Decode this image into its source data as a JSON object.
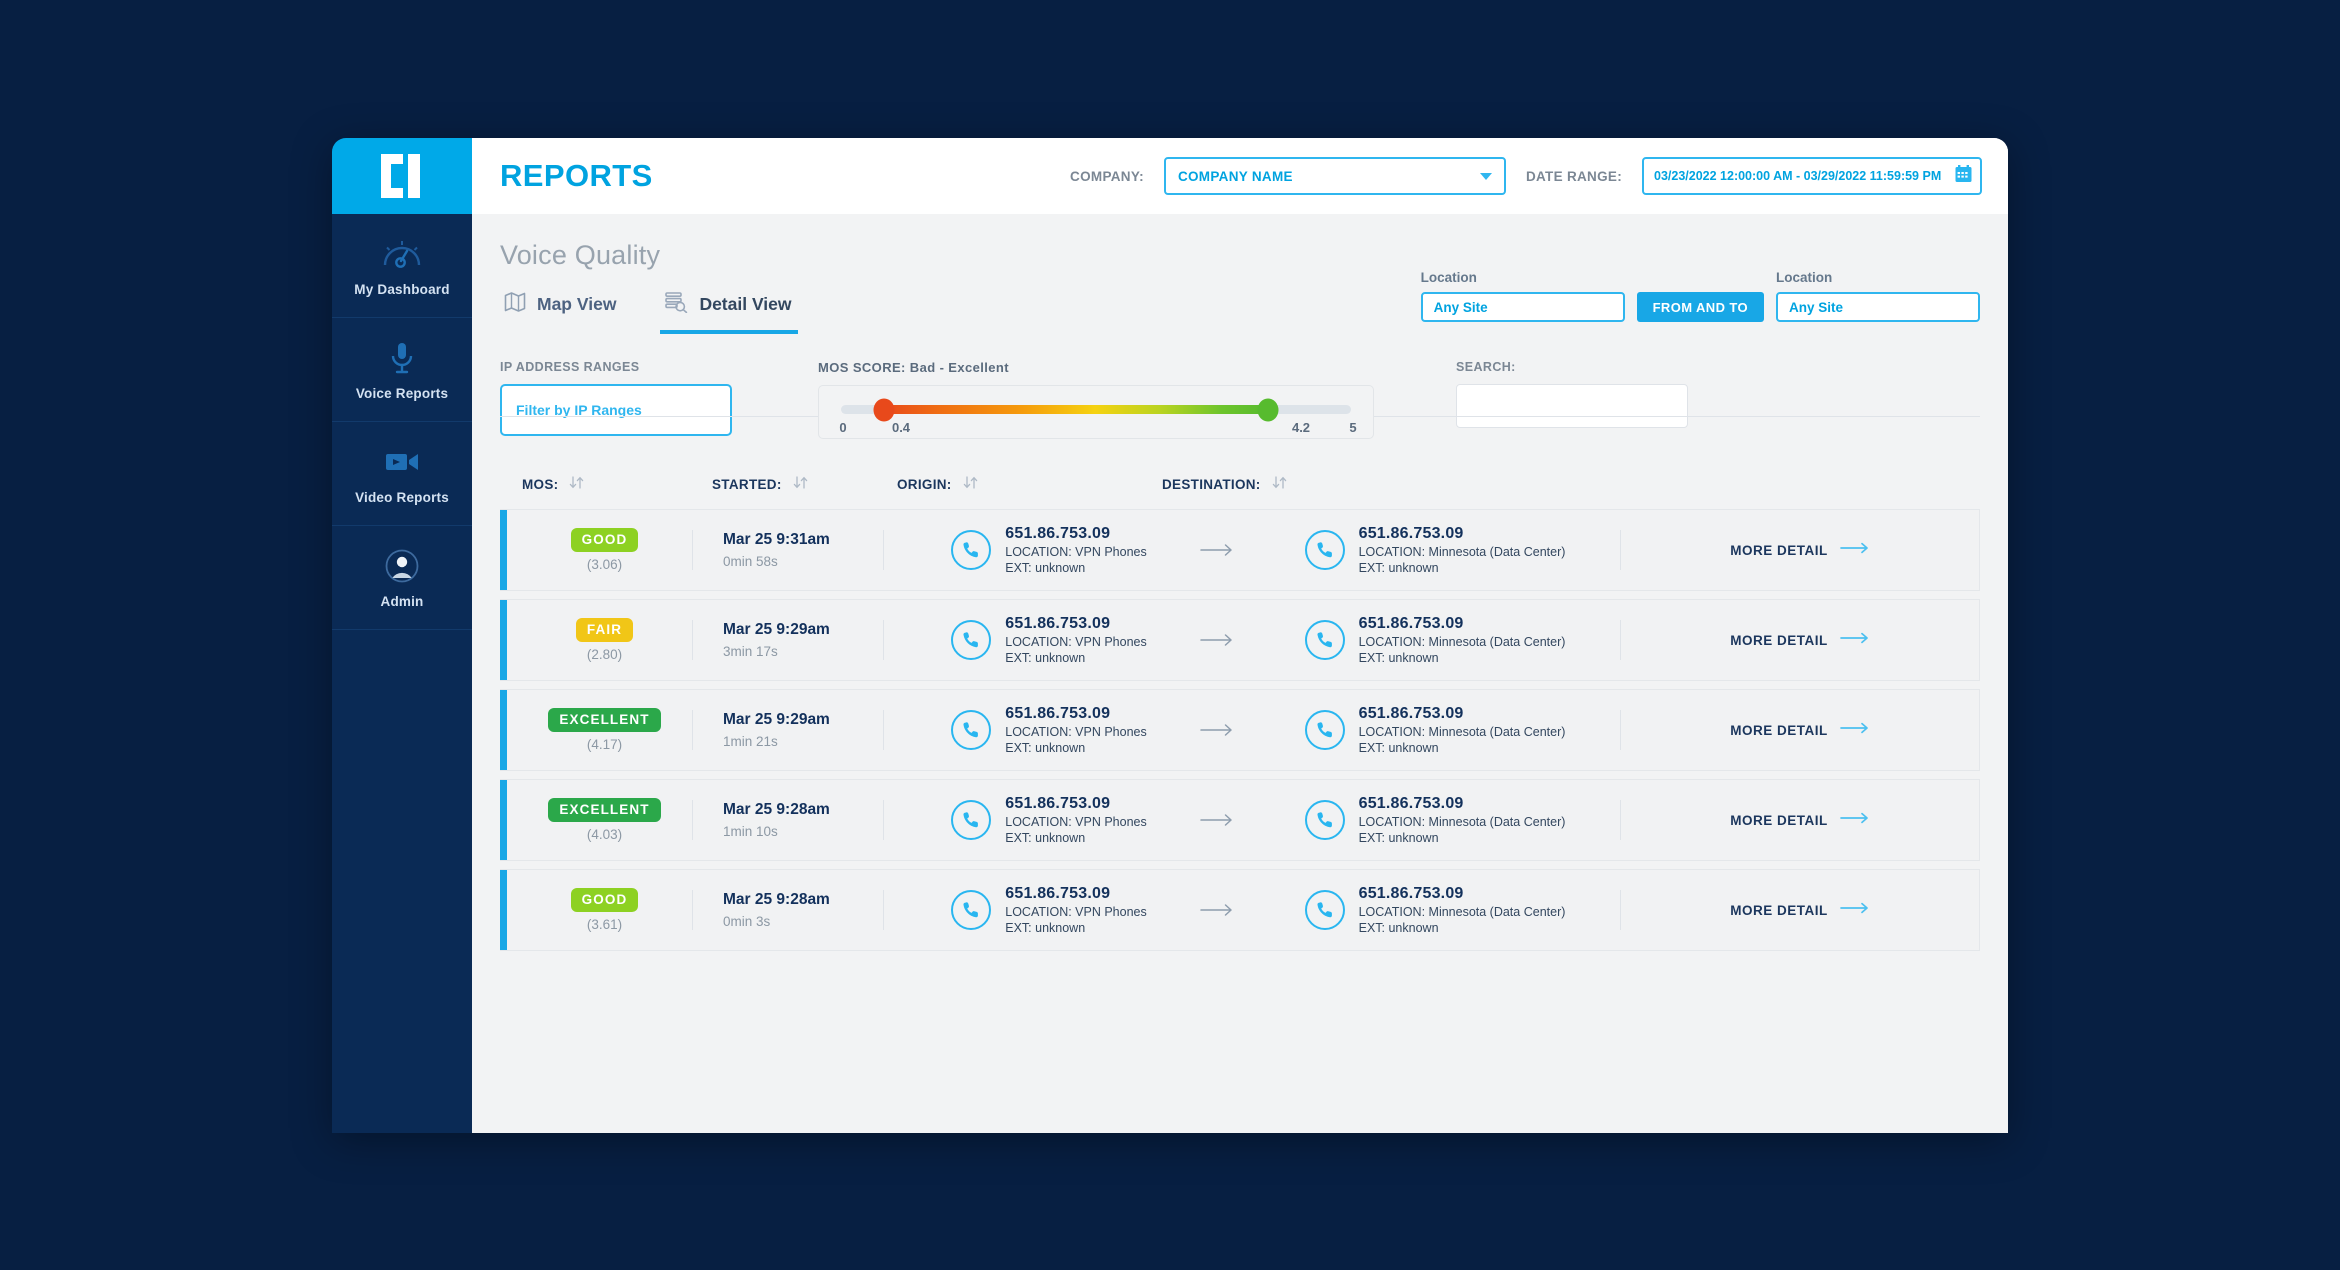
{
  "sidebar": {
    "logo_name": "c1-logo",
    "items": [
      {
        "label": "My Dashboard",
        "icon": "gauge-icon"
      },
      {
        "label": "Voice Reports",
        "icon": "microphone-icon"
      },
      {
        "label": "Video Reports",
        "icon": "video-camera-icon"
      },
      {
        "label": "Admin",
        "icon": "user-avatar-icon"
      }
    ]
  },
  "topbar": {
    "title": "REPORTS",
    "company_label": "COMPANY:",
    "company_value": "COMPANY NAME",
    "date_range_label": "DATE RANGE:",
    "date_range_value": "03/23/2022 12:00:00 AM - 03/29/2022 11:59:59 PM"
  },
  "section": {
    "title": "Voice Quality",
    "tabs": [
      {
        "label": "Map View",
        "icon": "map-icon",
        "active": false
      },
      {
        "label": "Detail View",
        "icon": "detail-list-search-icon",
        "active": true
      }
    ]
  },
  "location": {
    "from_caption": "Location",
    "from_value": "Any Site",
    "button_label": "FROM AND TO",
    "to_caption": "Location",
    "to_value": "Any Site"
  },
  "filters": {
    "ip_caption": "IP ADDRESS RANGES",
    "ip_placeholder": "Filter by IP Ranges",
    "mos_caption": "MOS SCORE: Bad - Excellent",
    "mos_ticks": {
      "min": "0",
      "low": "0.4",
      "high": "4.2",
      "max": "5"
    },
    "search_caption": "SEARCH:",
    "search_value": ""
  },
  "table": {
    "headers": {
      "mos": "MOS:",
      "started": "STARTED:",
      "origin": "ORIGIN:",
      "destination": "DESTINATION:"
    },
    "sort_icon": "sort-updown-icon",
    "more_detail_label": "MORE DETAIL",
    "rows": [
      {
        "quality": "GOOD",
        "quality_class": "good",
        "score": "(3.06)",
        "started": "Mar 25 9:31am",
        "duration": "0min 58s",
        "origin_number": "651.86.753.09",
        "origin_location": "LOCATION: VPN Phones",
        "origin_ext": "EXT: unknown",
        "dest_number": "651.86.753.09",
        "dest_location": "LOCATION: Minnesota (Data Center)",
        "dest_ext": "EXT: unknown"
      },
      {
        "quality": "FAIR",
        "quality_class": "fair",
        "score": "(2.80)",
        "started": "Mar 25 9:29am",
        "duration": "3min 17s",
        "origin_number": "651.86.753.09",
        "origin_location": "LOCATION: VPN Phones",
        "origin_ext": "EXT: unknown",
        "dest_number": "651.86.753.09",
        "dest_location": "LOCATION: Minnesota (Data Center)",
        "dest_ext": "EXT: unknown"
      },
      {
        "quality": "EXCELLENT",
        "quality_class": "excellent",
        "score": "(4.17)",
        "started": "Mar 25 9:29am",
        "duration": "1min 21s",
        "origin_number": "651.86.753.09",
        "origin_location": "LOCATION: VPN Phones",
        "origin_ext": "EXT: unknown",
        "dest_number": "651.86.753.09",
        "dest_location": "LOCATION: Minnesota (Data Center)",
        "dest_ext": "EXT: unknown"
      },
      {
        "quality": "EXCELLENT",
        "quality_class": "excellent",
        "score": "(4.03)",
        "started": "Mar 25 9:28am",
        "duration": "1min 10s",
        "origin_number": "651.86.753.09",
        "origin_location": "LOCATION: VPN Phones",
        "origin_ext": "EXT: unknown",
        "dest_number": "651.86.753.09",
        "dest_location": "LOCATION: Minnesota (Data Center)",
        "dest_ext": "EXT: unknown"
      },
      {
        "quality": "GOOD",
        "quality_class": "good",
        "score": "(3.61)",
        "started": "Mar 25 9:28am",
        "duration": "0min 3s",
        "origin_number": "651.86.753.09",
        "origin_location": "LOCATION: VPN Phones",
        "origin_ext": "EXT: unknown",
        "dest_number": "651.86.753.09",
        "dest_location": "LOCATION: Minnesota (Data Center)",
        "dest_ext": "EXT: unknown"
      }
    ]
  },
  "colors": {
    "page_background": "#071f42",
    "sidebar": "#0a2a55",
    "brand_cyan": "#00a9e8",
    "accent_blue": "#18a7e6",
    "title_blue": "#00a3e0",
    "good": "#8dd122",
    "fair": "#f1c617",
    "excellent": "#2ba84a",
    "navy_text": "#13315c"
  }
}
